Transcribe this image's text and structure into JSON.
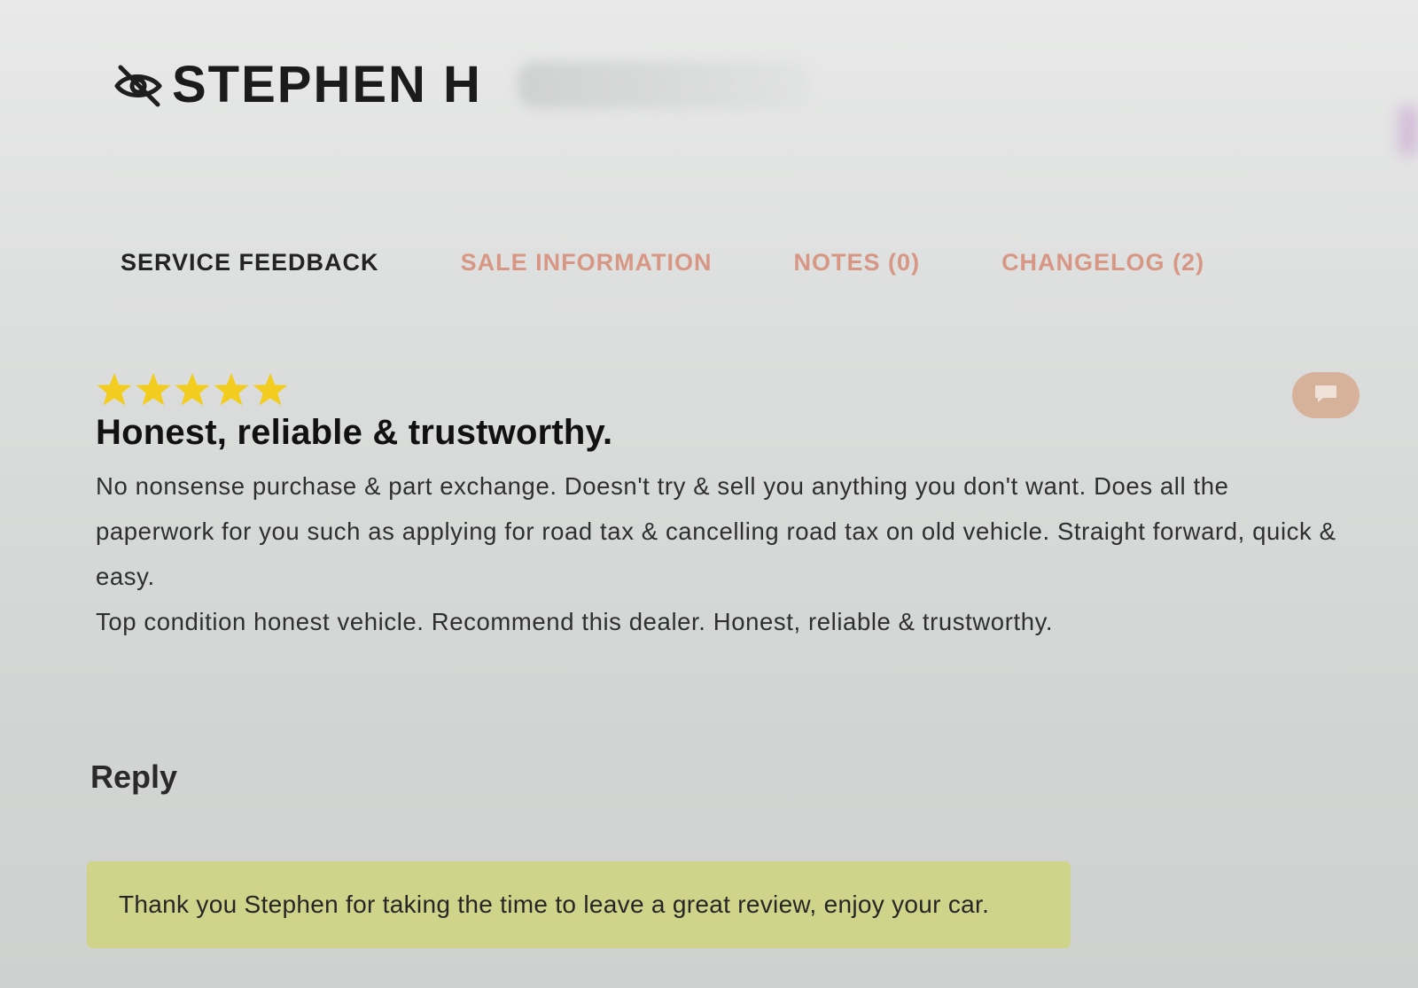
{
  "header": {
    "customer_name": "STEPHEN H",
    "visibility_icon": "eye-off-icon"
  },
  "tabs": [
    {
      "label": "SERVICE FEEDBACK",
      "active": true
    },
    {
      "label": "SALE INFORMATION",
      "active": false
    },
    {
      "label": "NOTES (0)",
      "active": false
    },
    {
      "label": "CHANGELOG (2)",
      "active": false
    }
  ],
  "review": {
    "rating": 5,
    "rating_max": 5,
    "star_icon": "star-icon",
    "title": "Honest, reliable & trustworthy.",
    "body_paragraph_1": "No nonsense purchase & part exchange. Doesn't try & sell you anything you don't want. Does all the paperwork for you such as applying for road tax & cancelling road tax on old vehicle. Straight forward, quick & easy.",
    "body_paragraph_2": "Top condition honest vehicle. Recommend this dealer. Honest, reliable & trustworthy.",
    "comment_icon": "comment-icon"
  },
  "reply": {
    "heading": "Reply",
    "text": "Thank you Stephen for taking the time to leave a great review, enjoy your car."
  },
  "colors": {
    "background": "#dcdedd",
    "tab_active": "#232323",
    "tab_inactive": "#d79784",
    "star": "#f2cd1f",
    "reply_box": "#d0d48a",
    "comment_button": "#d7a88c"
  }
}
